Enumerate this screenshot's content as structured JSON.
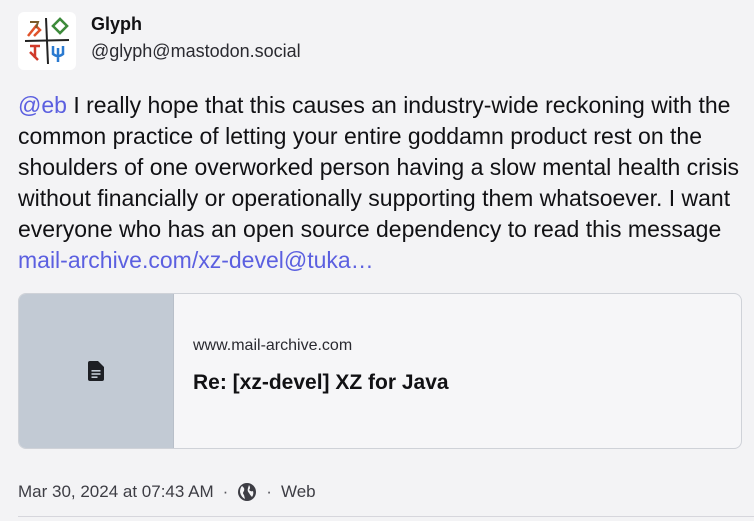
{
  "author": {
    "display_name": "Glyph",
    "handle": "@glyph@mastodon.social",
    "avatar_icon": "glyph-logo"
  },
  "post": {
    "mention": "@eb",
    "text": " I really hope that this causes an industry-wide reckoning with the common practice of letting your entire goddamn product rest on the shoulders of one overworked person having a slow mental health crisis without financially or operationally supporting them whatsoever. I want everyone who has an open source dependency to read this message ",
    "link_text": "mail-archive.com/xz-devel@tuka…"
  },
  "card": {
    "icon": "document-icon",
    "host": "www.mail-archive.com",
    "title": "Re: [xz-devel] XZ for Java"
  },
  "meta": {
    "timestamp": "Mar 30, 2024 at 07:43 AM",
    "separator": "·",
    "visibility_icon": "globe-icon",
    "client": "Web"
  },
  "colors": {
    "link": "#5b5fe0",
    "card_thumb": "#c2cad4",
    "background": "#f3f3f5"
  }
}
